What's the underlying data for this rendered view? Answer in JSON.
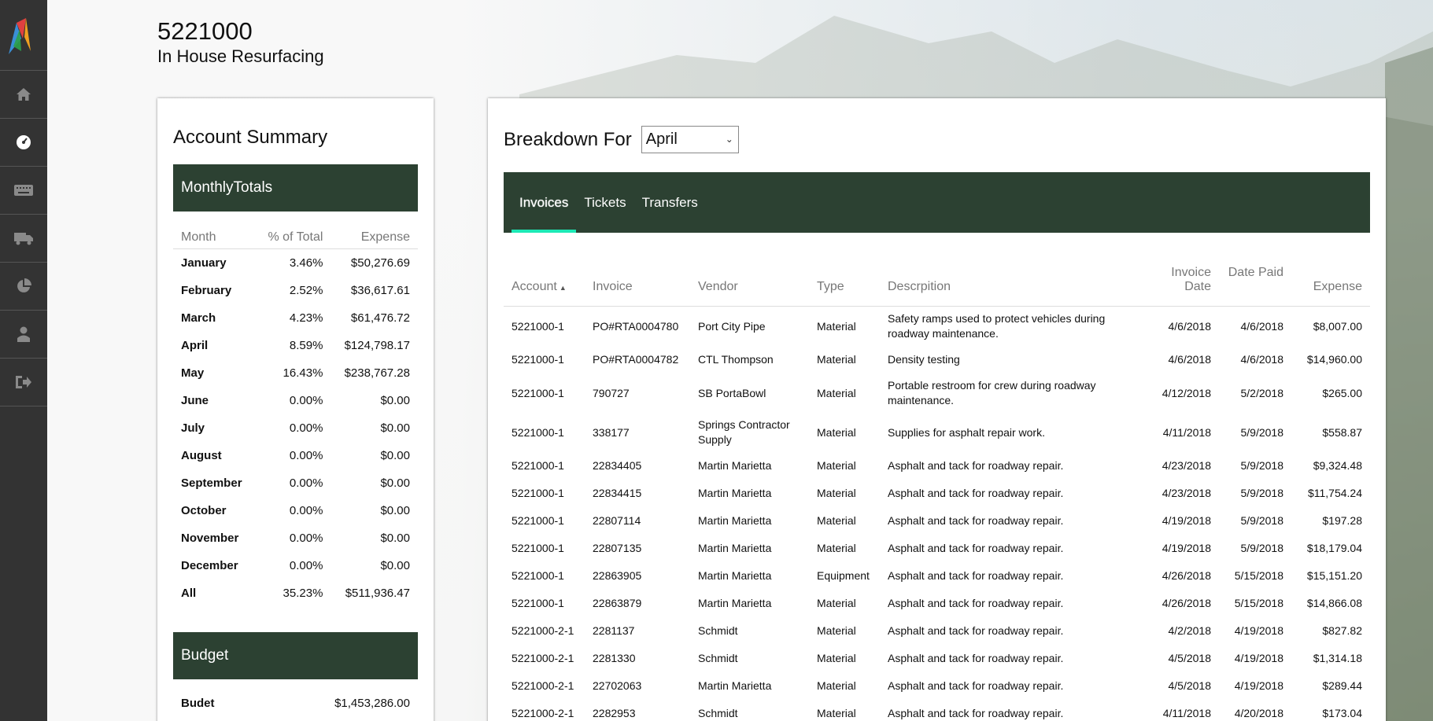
{
  "header": {
    "title": "5221000",
    "subtitle": "In House Resurfacing"
  },
  "sidebar": {
    "items": [
      {
        "icon": "home-icon"
      },
      {
        "icon": "dashboard-icon",
        "active": true
      },
      {
        "icon": "keyboard-icon"
      },
      {
        "icon": "truck-icon"
      },
      {
        "icon": "pie-chart-icon"
      },
      {
        "icon": "user-icon"
      },
      {
        "icon": "logout-icon"
      }
    ]
  },
  "summary": {
    "title": "Account Summary",
    "monthly_header": "MonthlyTotals",
    "columns": [
      "Month",
      "% of Total",
      "Expense"
    ],
    "rows": [
      [
        "January",
        "3.46%",
        "$50,276.69"
      ],
      [
        "February",
        "2.52%",
        "$36,617.61"
      ],
      [
        "March",
        "4.23%",
        "$61,476.72"
      ],
      [
        "April",
        "8.59%",
        "$124,798.17"
      ],
      [
        "May",
        "16.43%",
        "$238,767.28"
      ],
      [
        "June",
        "0.00%",
        "$0.00"
      ],
      [
        "July",
        "0.00%",
        "$0.00"
      ],
      [
        "August",
        "0.00%",
        "$0.00"
      ],
      [
        "September",
        "0.00%",
        "$0.00"
      ],
      [
        "October",
        "0.00%",
        "$0.00"
      ],
      [
        "November",
        "0.00%",
        "$0.00"
      ],
      [
        "December",
        "0.00%",
        "$0.00"
      ],
      [
        "All",
        "35.23%",
        "$511,936.47"
      ]
    ],
    "budget_header": "Budget",
    "budget_label": "Budet",
    "budget_value": "$1,453,286.00"
  },
  "breakdown": {
    "label": "Breakdown For",
    "selected_month": "April",
    "tabs": [
      "Invoices",
      "Tickets",
      "Transfers"
    ],
    "active_tab": "Invoices",
    "columns": [
      "Account",
      "Invoice",
      "Vendor",
      "Type",
      "Descrpition",
      "Invoice Date",
      "Date Paid",
      "Expense"
    ],
    "rows": [
      [
        "5221000-1",
        "PO#RTA0004780",
        "Port City Pipe",
        "Material",
        "Safety ramps used to protect vehicles during roadway maintenance.",
        "4/6/2018",
        "4/6/2018",
        "$8,007.00"
      ],
      [
        "5221000-1",
        "PO#RTA0004782",
        "CTL Thompson",
        "Material",
        "Density testing",
        "4/6/2018",
        "4/6/2018",
        "$14,960.00"
      ],
      [
        "5221000-1",
        "790727",
        "SB PortaBowl",
        "Material",
        "Portable restroom for crew during roadway maintenance.",
        "4/12/2018",
        "5/2/2018",
        "$265.00"
      ],
      [
        "5221000-1",
        "338177",
        "Springs Contractor Supply",
        "Material",
        "Supplies for asphalt repair work.",
        "4/11/2018",
        "5/9/2018",
        "$558.87"
      ],
      [
        "5221000-1",
        "22834405",
        "Martin Marietta",
        "Material",
        "Asphalt and tack for roadway repair.",
        "4/23/2018",
        "5/9/2018",
        "$9,324.48"
      ],
      [
        "5221000-1",
        "22834415",
        "Martin Marietta",
        "Material",
        "Asphalt and tack for roadway repair.",
        "4/23/2018",
        "5/9/2018",
        "$11,754.24"
      ],
      [
        "5221000-1",
        "22807114",
        "Martin Marietta",
        "Material",
        "Asphalt and tack for roadway repair.",
        "4/19/2018",
        "5/9/2018",
        "$197.28"
      ],
      [
        "5221000-1",
        "22807135",
        "Martin Marietta",
        "Material",
        "Asphalt and tack for roadway repair.",
        "4/19/2018",
        "5/9/2018",
        "$18,179.04"
      ],
      [
        "5221000-1",
        "22863905",
        "Martin Marietta",
        "Equipment",
        "Asphalt and tack for roadway repair.",
        "4/26/2018",
        "5/15/2018",
        "$15,151.20"
      ],
      [
        "5221000-1",
        "22863879",
        "Martin Marietta",
        "Material",
        "Asphalt and tack for roadway repair.",
        "4/26/2018",
        "5/15/2018",
        "$14,866.08"
      ],
      [
        "5221000-2-1",
        "2281137",
        "Schmidt",
        "Material",
        "Asphalt and tack for roadway repair.",
        "4/2/2018",
        "4/19/2018",
        "$827.82"
      ],
      [
        "5221000-2-1",
        "2281330",
        "Schmidt",
        "Material",
        "Asphalt and tack for roadway repair.",
        "4/5/2018",
        "4/19/2018",
        "$1,314.18"
      ],
      [
        "5221000-2-1",
        "22702063",
        "Martin Marietta",
        "Material",
        "Asphalt and tack for roadway repair.",
        "4/5/2018",
        "4/19/2018",
        "$289.44"
      ],
      [
        "5221000-2-1",
        "2282953",
        "Schmidt",
        "Material",
        "Asphalt and tack for roadway repair.",
        "4/11/2018",
        "4/20/2018",
        "$173.04"
      ]
    ]
  },
  "colors": {
    "sidebar": "#333333",
    "header_green": "#2c4132",
    "tab_accent": "#1de9b6"
  }
}
